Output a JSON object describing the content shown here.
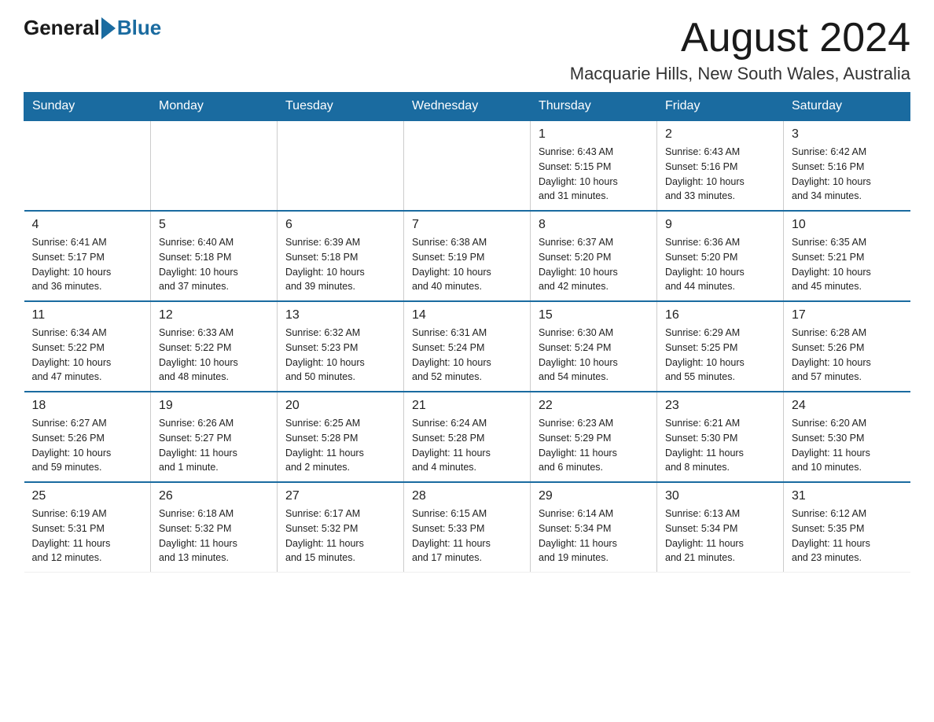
{
  "logo": {
    "general": "General",
    "blue": "Blue"
  },
  "title": {
    "month_year": "August 2024",
    "location": "Macquarie Hills, New South Wales, Australia"
  },
  "weekdays": [
    "Sunday",
    "Monday",
    "Tuesday",
    "Wednesday",
    "Thursday",
    "Friday",
    "Saturday"
  ],
  "weeks": [
    [
      {
        "day": "",
        "info": ""
      },
      {
        "day": "",
        "info": ""
      },
      {
        "day": "",
        "info": ""
      },
      {
        "day": "",
        "info": ""
      },
      {
        "day": "1",
        "info": "Sunrise: 6:43 AM\nSunset: 5:15 PM\nDaylight: 10 hours\nand 31 minutes."
      },
      {
        "day": "2",
        "info": "Sunrise: 6:43 AM\nSunset: 5:16 PM\nDaylight: 10 hours\nand 33 minutes."
      },
      {
        "day": "3",
        "info": "Sunrise: 6:42 AM\nSunset: 5:16 PM\nDaylight: 10 hours\nand 34 minutes."
      }
    ],
    [
      {
        "day": "4",
        "info": "Sunrise: 6:41 AM\nSunset: 5:17 PM\nDaylight: 10 hours\nand 36 minutes."
      },
      {
        "day": "5",
        "info": "Sunrise: 6:40 AM\nSunset: 5:18 PM\nDaylight: 10 hours\nand 37 minutes."
      },
      {
        "day": "6",
        "info": "Sunrise: 6:39 AM\nSunset: 5:18 PM\nDaylight: 10 hours\nand 39 minutes."
      },
      {
        "day": "7",
        "info": "Sunrise: 6:38 AM\nSunset: 5:19 PM\nDaylight: 10 hours\nand 40 minutes."
      },
      {
        "day": "8",
        "info": "Sunrise: 6:37 AM\nSunset: 5:20 PM\nDaylight: 10 hours\nand 42 minutes."
      },
      {
        "day": "9",
        "info": "Sunrise: 6:36 AM\nSunset: 5:20 PM\nDaylight: 10 hours\nand 44 minutes."
      },
      {
        "day": "10",
        "info": "Sunrise: 6:35 AM\nSunset: 5:21 PM\nDaylight: 10 hours\nand 45 minutes."
      }
    ],
    [
      {
        "day": "11",
        "info": "Sunrise: 6:34 AM\nSunset: 5:22 PM\nDaylight: 10 hours\nand 47 minutes."
      },
      {
        "day": "12",
        "info": "Sunrise: 6:33 AM\nSunset: 5:22 PM\nDaylight: 10 hours\nand 48 minutes."
      },
      {
        "day": "13",
        "info": "Sunrise: 6:32 AM\nSunset: 5:23 PM\nDaylight: 10 hours\nand 50 minutes."
      },
      {
        "day": "14",
        "info": "Sunrise: 6:31 AM\nSunset: 5:24 PM\nDaylight: 10 hours\nand 52 minutes."
      },
      {
        "day": "15",
        "info": "Sunrise: 6:30 AM\nSunset: 5:24 PM\nDaylight: 10 hours\nand 54 minutes."
      },
      {
        "day": "16",
        "info": "Sunrise: 6:29 AM\nSunset: 5:25 PM\nDaylight: 10 hours\nand 55 minutes."
      },
      {
        "day": "17",
        "info": "Sunrise: 6:28 AM\nSunset: 5:26 PM\nDaylight: 10 hours\nand 57 minutes."
      }
    ],
    [
      {
        "day": "18",
        "info": "Sunrise: 6:27 AM\nSunset: 5:26 PM\nDaylight: 10 hours\nand 59 minutes."
      },
      {
        "day": "19",
        "info": "Sunrise: 6:26 AM\nSunset: 5:27 PM\nDaylight: 11 hours\nand 1 minute."
      },
      {
        "day": "20",
        "info": "Sunrise: 6:25 AM\nSunset: 5:28 PM\nDaylight: 11 hours\nand 2 minutes."
      },
      {
        "day": "21",
        "info": "Sunrise: 6:24 AM\nSunset: 5:28 PM\nDaylight: 11 hours\nand 4 minutes."
      },
      {
        "day": "22",
        "info": "Sunrise: 6:23 AM\nSunset: 5:29 PM\nDaylight: 11 hours\nand 6 minutes."
      },
      {
        "day": "23",
        "info": "Sunrise: 6:21 AM\nSunset: 5:30 PM\nDaylight: 11 hours\nand 8 minutes."
      },
      {
        "day": "24",
        "info": "Sunrise: 6:20 AM\nSunset: 5:30 PM\nDaylight: 11 hours\nand 10 minutes."
      }
    ],
    [
      {
        "day": "25",
        "info": "Sunrise: 6:19 AM\nSunset: 5:31 PM\nDaylight: 11 hours\nand 12 minutes."
      },
      {
        "day": "26",
        "info": "Sunrise: 6:18 AM\nSunset: 5:32 PM\nDaylight: 11 hours\nand 13 minutes."
      },
      {
        "day": "27",
        "info": "Sunrise: 6:17 AM\nSunset: 5:32 PM\nDaylight: 11 hours\nand 15 minutes."
      },
      {
        "day": "28",
        "info": "Sunrise: 6:15 AM\nSunset: 5:33 PM\nDaylight: 11 hours\nand 17 minutes."
      },
      {
        "day": "29",
        "info": "Sunrise: 6:14 AM\nSunset: 5:34 PM\nDaylight: 11 hours\nand 19 minutes."
      },
      {
        "day": "30",
        "info": "Sunrise: 6:13 AM\nSunset: 5:34 PM\nDaylight: 11 hours\nand 21 minutes."
      },
      {
        "day": "31",
        "info": "Sunrise: 6:12 AM\nSunset: 5:35 PM\nDaylight: 11 hours\nand 23 minutes."
      }
    ]
  ]
}
